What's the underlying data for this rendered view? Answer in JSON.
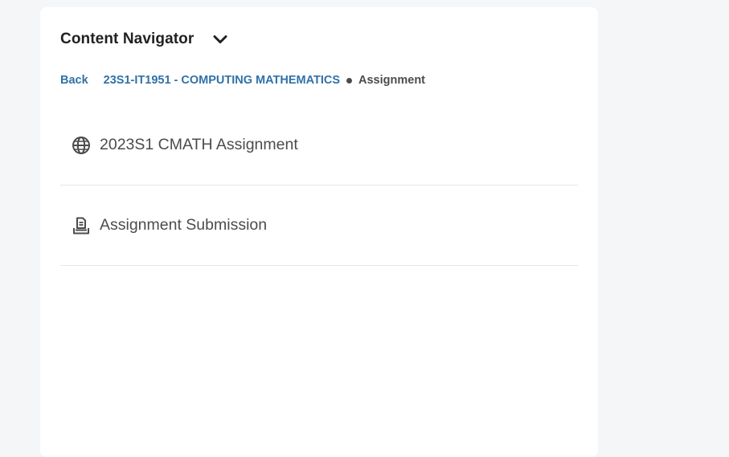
{
  "navigator": {
    "title": "Content Navigator",
    "toggle_icon": "chevron-down-icon"
  },
  "breadcrumb": {
    "back_label": "Back",
    "course_label": "23S1-IT1951 - COMPUTING MATHEMATICS",
    "current_label": "Assignment"
  },
  "items": [
    {
      "label": "2023S1 CMATH Assignment",
      "icon": "globe-icon"
    },
    {
      "label": "Assignment Submission",
      "icon": "assignment-submission-icon"
    }
  ],
  "colors": {
    "background": "#f5f6f8",
    "panel": "#ffffff",
    "link": "#3071a8",
    "text": "#494c4e",
    "title": "#202122",
    "divider": "#e3e5e8"
  }
}
